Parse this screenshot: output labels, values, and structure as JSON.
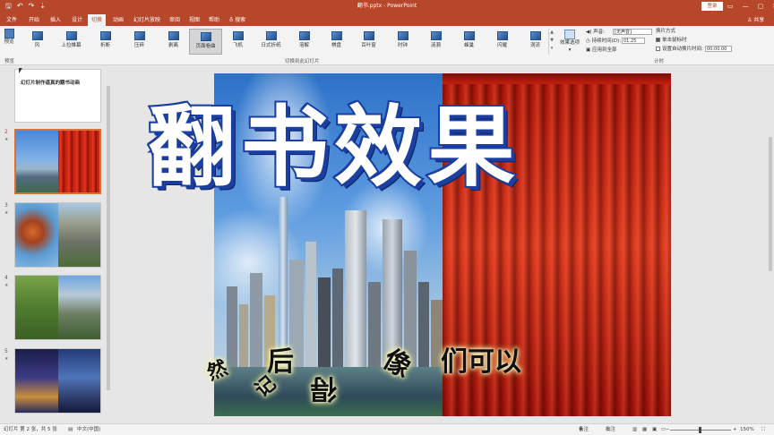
{
  "titlebar": {
    "doc_title": "翻书.pptx  -  PowerPoint",
    "login_label": "登录",
    "qat": {
      "save": "🖫",
      "undo": "↶",
      "redo": "↷",
      "more": "⇣"
    },
    "window_controls": {
      "ribbon_options": "▭",
      "minimize": "—",
      "restore": "▢",
      "close": "✕"
    }
  },
  "menu": {
    "tabs": [
      "文件",
      "开始",
      "插入",
      "设计",
      "切换",
      "动画",
      "幻灯片放映",
      "审阅",
      "视图",
      "帮助",
      "搜索"
    ],
    "active_tab": "切换",
    "search_icon": "lightbulb-icon",
    "share_label": "♙ 共享"
  },
  "ribbon": {
    "preview_label": "预览",
    "preview_group_label": "预览",
    "effects": [
      "风",
      "上拉帷幕",
      "折断",
      "压碎",
      "剥离",
      "页面卷曲",
      "飞机",
      "日式折纸",
      "溶解",
      "棋盘",
      "百叶窗",
      "时钟",
      "涟漪",
      "蜂巢",
      "闪耀",
      "涡流"
    ],
    "selected_effect": "页面卷曲",
    "group_label": "切换到此幻灯片",
    "effect_options_label": "效果选项",
    "timing": {
      "sound_label": "声音:",
      "sound_value": "[无声音]",
      "duration_label": "持续时间(D):",
      "duration_value": "01.25",
      "apply_all_label": "应用到全部",
      "advance_label": "换片方式",
      "on_click_label": "单击鼠标时",
      "on_click_checked": true,
      "after_label": "设置自动换片时间:",
      "after_value": "00:00.00",
      "after_checked": false,
      "group_label": "计时"
    }
  },
  "thumbnails": {
    "slide1_text": "幻灯片制作逼真的翻书动画",
    "numbers": [
      "2",
      "3",
      "4",
      "5"
    ],
    "star_mark": "★",
    "selected": "2"
  },
  "slide": {
    "title": "翻书效果",
    "subtitle_chars": [
      "然",
      "后",
      "记",
      "得",
      "像",
      "们可以"
    ]
  },
  "statusbar": {
    "slide_info": "幻灯片 第 2 张，共 5 张",
    "language": "中文(中国)",
    "notes_label": "备注",
    "comments_label": "批注",
    "zoom_value": "150%"
  },
  "colors": {
    "accent": "#b7472a",
    "ribbon_bg": "#f3f3f3",
    "selected_thumb_border": "#d8703d",
    "title_outline": "#1b3fa0"
  }
}
